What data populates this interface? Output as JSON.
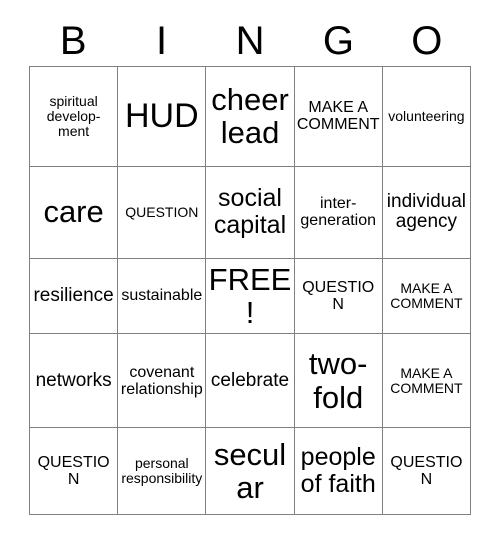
{
  "card": {
    "header_letters": [
      "B",
      "I",
      "N",
      "G",
      "O"
    ],
    "free_space_label": "FREE!",
    "colors": {
      "background": "#ffffff",
      "text": "#000000",
      "grid_line": "#808080"
    },
    "rows": [
      [
        {
          "text": "spiritual develop-ment",
          "size": "sm"
        },
        {
          "text": "HUD",
          "size": "huge"
        },
        {
          "text": "cheer lead",
          "size": "xxl"
        },
        {
          "text": "MAKE A COMMENT",
          "size": "md"
        },
        {
          "text": "volunteering",
          "size": "sm"
        }
      ],
      [
        {
          "text": "care",
          "size": "xxl"
        },
        {
          "text": "QUESTION",
          "size": "sm"
        },
        {
          "text": "social capital",
          "size": "xl"
        },
        {
          "text": "inter-generation",
          "size": "md"
        },
        {
          "text": "individual agency",
          "size": "lg"
        }
      ],
      [
        {
          "text": "resilience",
          "size": "lg"
        },
        {
          "text": "sustainable",
          "size": "md"
        },
        {
          "text": "FREE!",
          "size": "xxl"
        },
        {
          "text": "QUESTION",
          "size": "md"
        },
        {
          "text": "MAKE A COMMENT",
          "size": "sm"
        }
      ],
      [
        {
          "text": "networks",
          "size": "lg"
        },
        {
          "text": "covenant relationship",
          "size": "md"
        },
        {
          "text": "celebrate",
          "size": "lg"
        },
        {
          "text": "two-fold",
          "size": "xxl"
        },
        {
          "text": "MAKE A COMMENT",
          "size": "sm"
        }
      ],
      [
        {
          "text": "QUESTION",
          "size": "md"
        },
        {
          "text": "personal responsibility",
          "size": "sm"
        },
        {
          "text": "secular",
          "size": "xxl"
        },
        {
          "text": "people of faith",
          "size": "xl"
        },
        {
          "text": "QUESTION",
          "size": "md"
        }
      ]
    ]
  }
}
